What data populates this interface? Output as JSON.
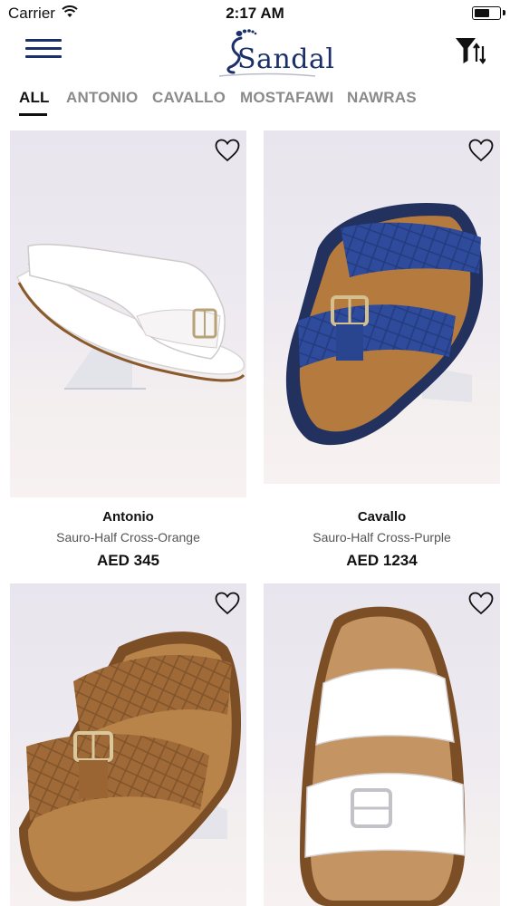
{
  "status_bar": {
    "carrier": "Carrier",
    "time": "2:17 AM",
    "battery_level": 0.55
  },
  "header": {
    "logo_text": "Sandal",
    "menu_icon": "hamburger-icon",
    "filter_icon": "filter-sort-icon"
  },
  "tabs": [
    {
      "label": "ALL",
      "active": true
    },
    {
      "label": "ANTONIO",
      "active": false
    },
    {
      "label": "CAVALLO",
      "active": false
    },
    {
      "label": "MOSTAFAWI",
      "active": false
    },
    {
      "label": "NAWRAS",
      "active": false
    }
  ],
  "products": [
    {
      "brand": "Antonio",
      "name": "Sauro-Half Cross-Orange",
      "price": "AED 345",
      "color": "white",
      "favorite": false
    },
    {
      "brand": "Cavallo",
      "name": "Sauro-Half Cross-Purple",
      "price": "AED 1234",
      "color": "navy",
      "favorite": false
    },
    {
      "brand": "",
      "name": "",
      "price": "",
      "color": "tan",
      "favorite": false
    },
    {
      "brand": "",
      "name": "",
      "price": "",
      "color": "white",
      "favorite": false
    }
  ],
  "colors": {
    "brand_navy": "#1b2f6b",
    "tab_inactive": "#8a8a8a",
    "tab_active": "#111111"
  }
}
